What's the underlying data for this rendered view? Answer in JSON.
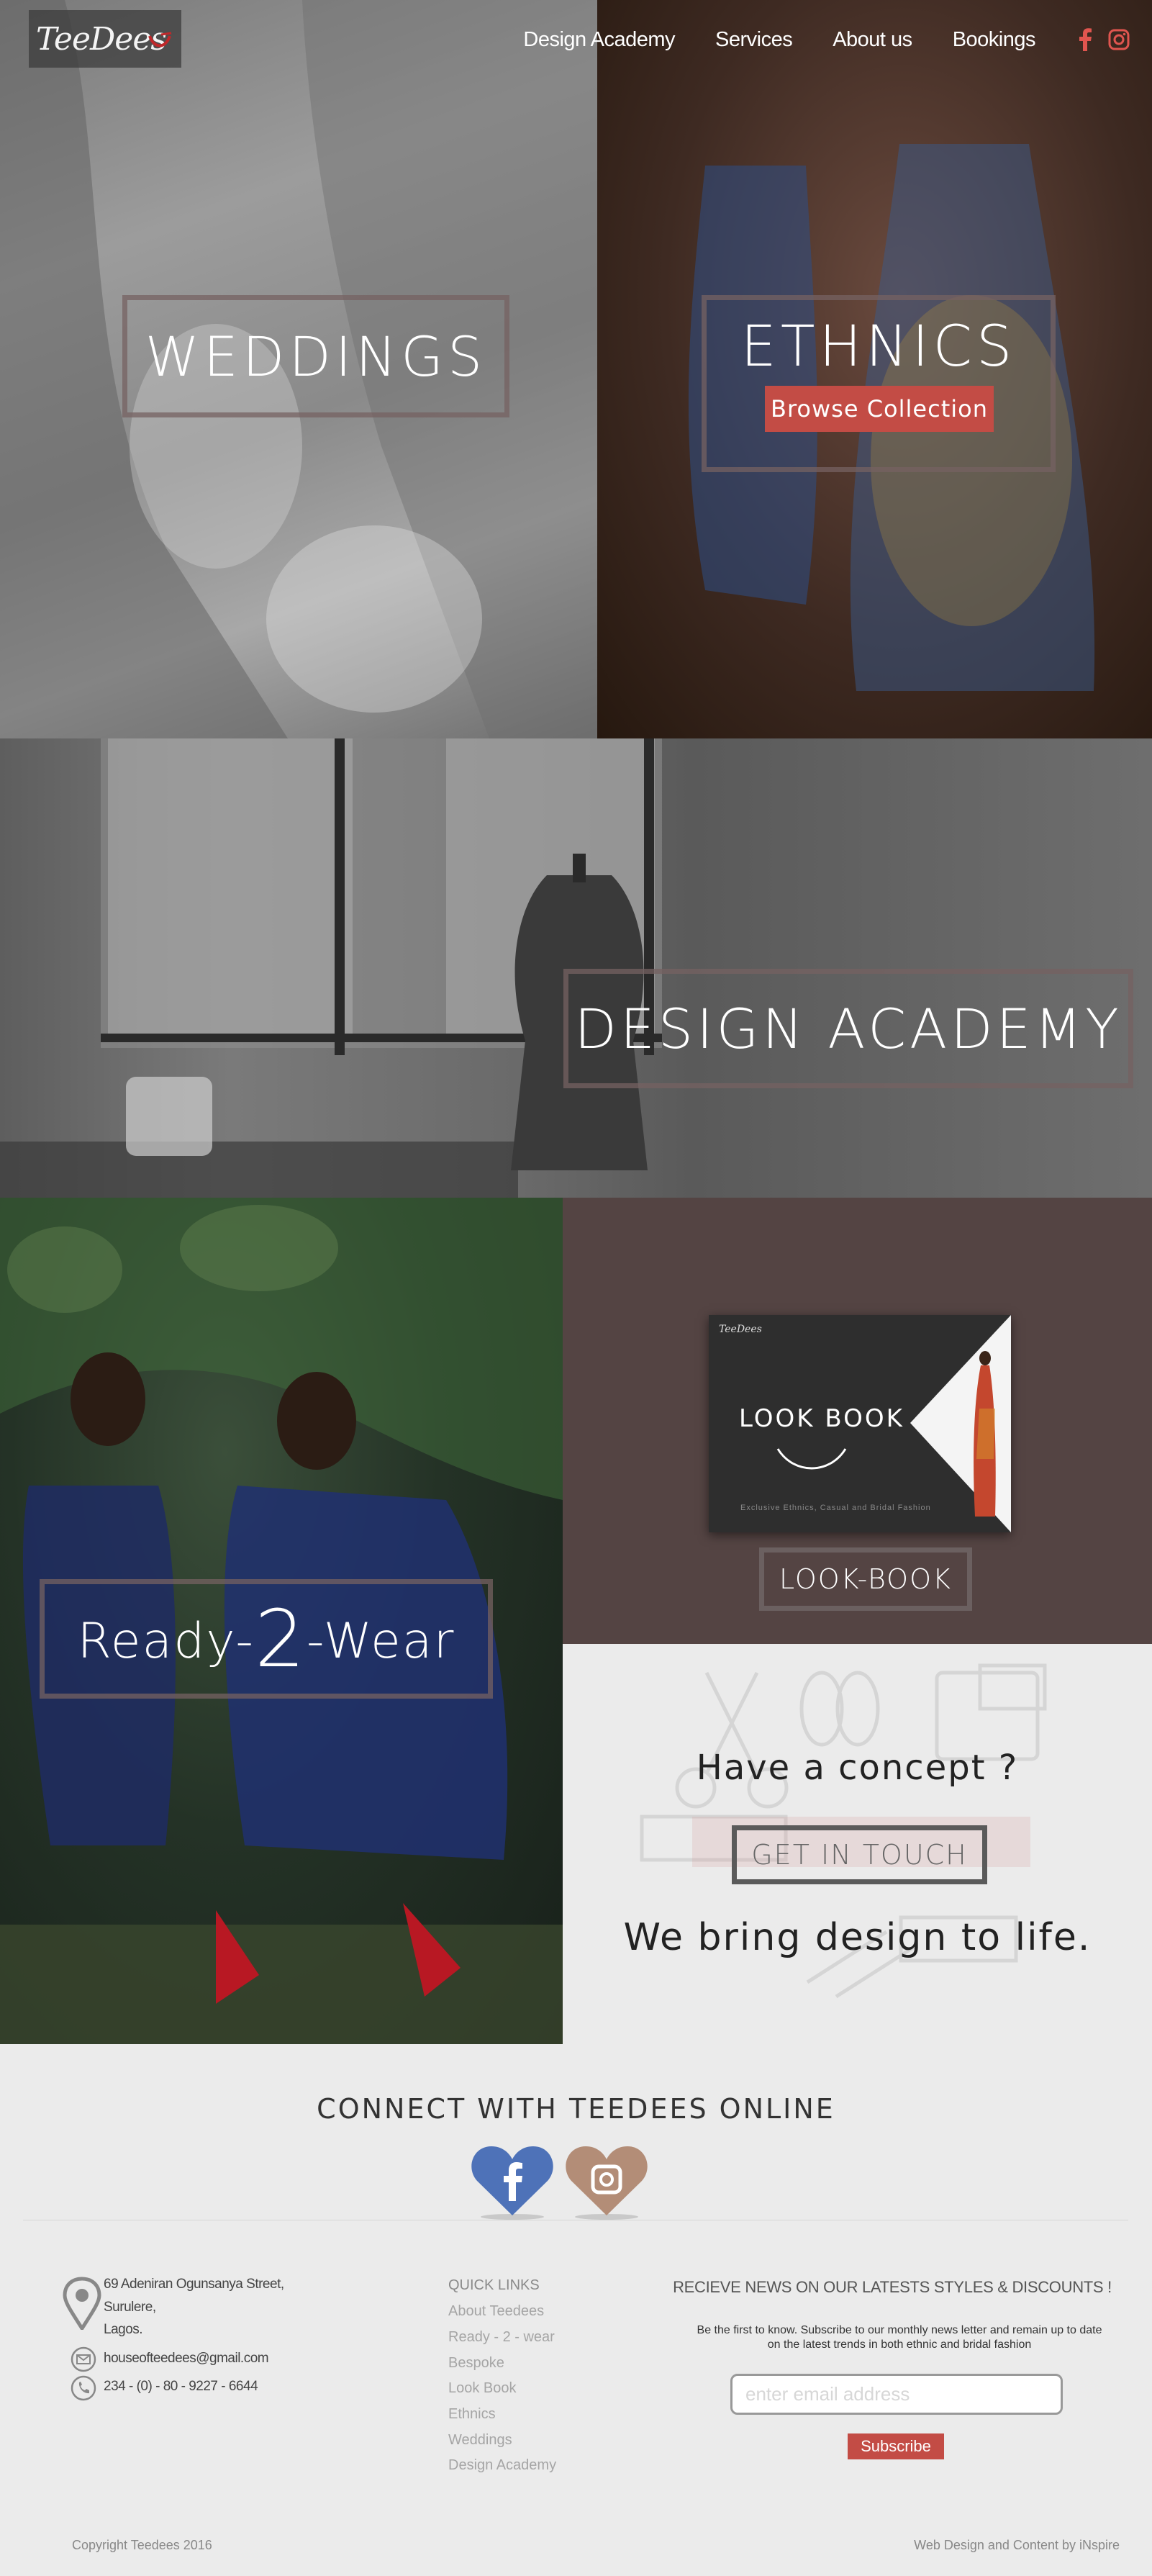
{
  "brand": {
    "logo_text": "TeeDees"
  },
  "nav": {
    "items": [
      {
        "label": "Design Academy"
      },
      {
        "label": "Services"
      },
      {
        "label": "About us"
      },
      {
        "label": "Bookings"
      }
    ],
    "icons": [
      "facebook-icon",
      "instagram-icon"
    ],
    "accent": "#e0554f"
  },
  "panels": {
    "weddings": {
      "title": "WEDDINGS"
    },
    "ethnics": {
      "title": "ETHNICS",
      "button": "Browse Collection"
    },
    "academy": {
      "title": "DESIGN ACADEMY"
    },
    "ready": {
      "pre": "Ready-",
      "num": "2",
      "post": "-Wear"
    },
    "lookbook": {
      "book_title": "LOOK BOOK",
      "book_sub": "Exclusive Ethnics, Casual and Bridal Fashion",
      "button": "LOOK-BOOK"
    },
    "concept": {
      "question": "Have a concept ?",
      "button": "GET IN TOUCH",
      "tagline": "We bring design to life."
    }
  },
  "connect": {
    "title": "CONNECT WITH TEEDEES ONLINE",
    "facebook_color": "#4e72b8",
    "instagram_color": "#b38d77"
  },
  "contact": {
    "address": [
      "69 Adeniran Ogunsanya Street,",
      "Surulere,",
      "Lagos."
    ],
    "email": "houseofteedees@gmail.com",
    "phone": "234 - (0) - 80 - 9227 - 6644"
  },
  "quick_links": {
    "title": "QUICK LINKS",
    "items": [
      "About Teedees",
      "Ready - 2 - wear",
      "Bespoke",
      "Look Book",
      "Ethnics",
      "Weddings",
      "Design Academy"
    ]
  },
  "newsletter": {
    "title": "RECIEVE NEWS ON OUR LATESTS STYLES & DISCOUNTS !",
    "body_line1": "Be the first to know. Subscribe to our monthly news letter  and remain up to date",
    "body_line2": "on the latest trends in both ethnic and bridal fashion",
    "placeholder": "enter email address",
    "button": "Subscribe"
  },
  "footer": {
    "copyright": "Copyright Teedees 2016",
    "credit": "Web Design and Content by iNspire"
  }
}
